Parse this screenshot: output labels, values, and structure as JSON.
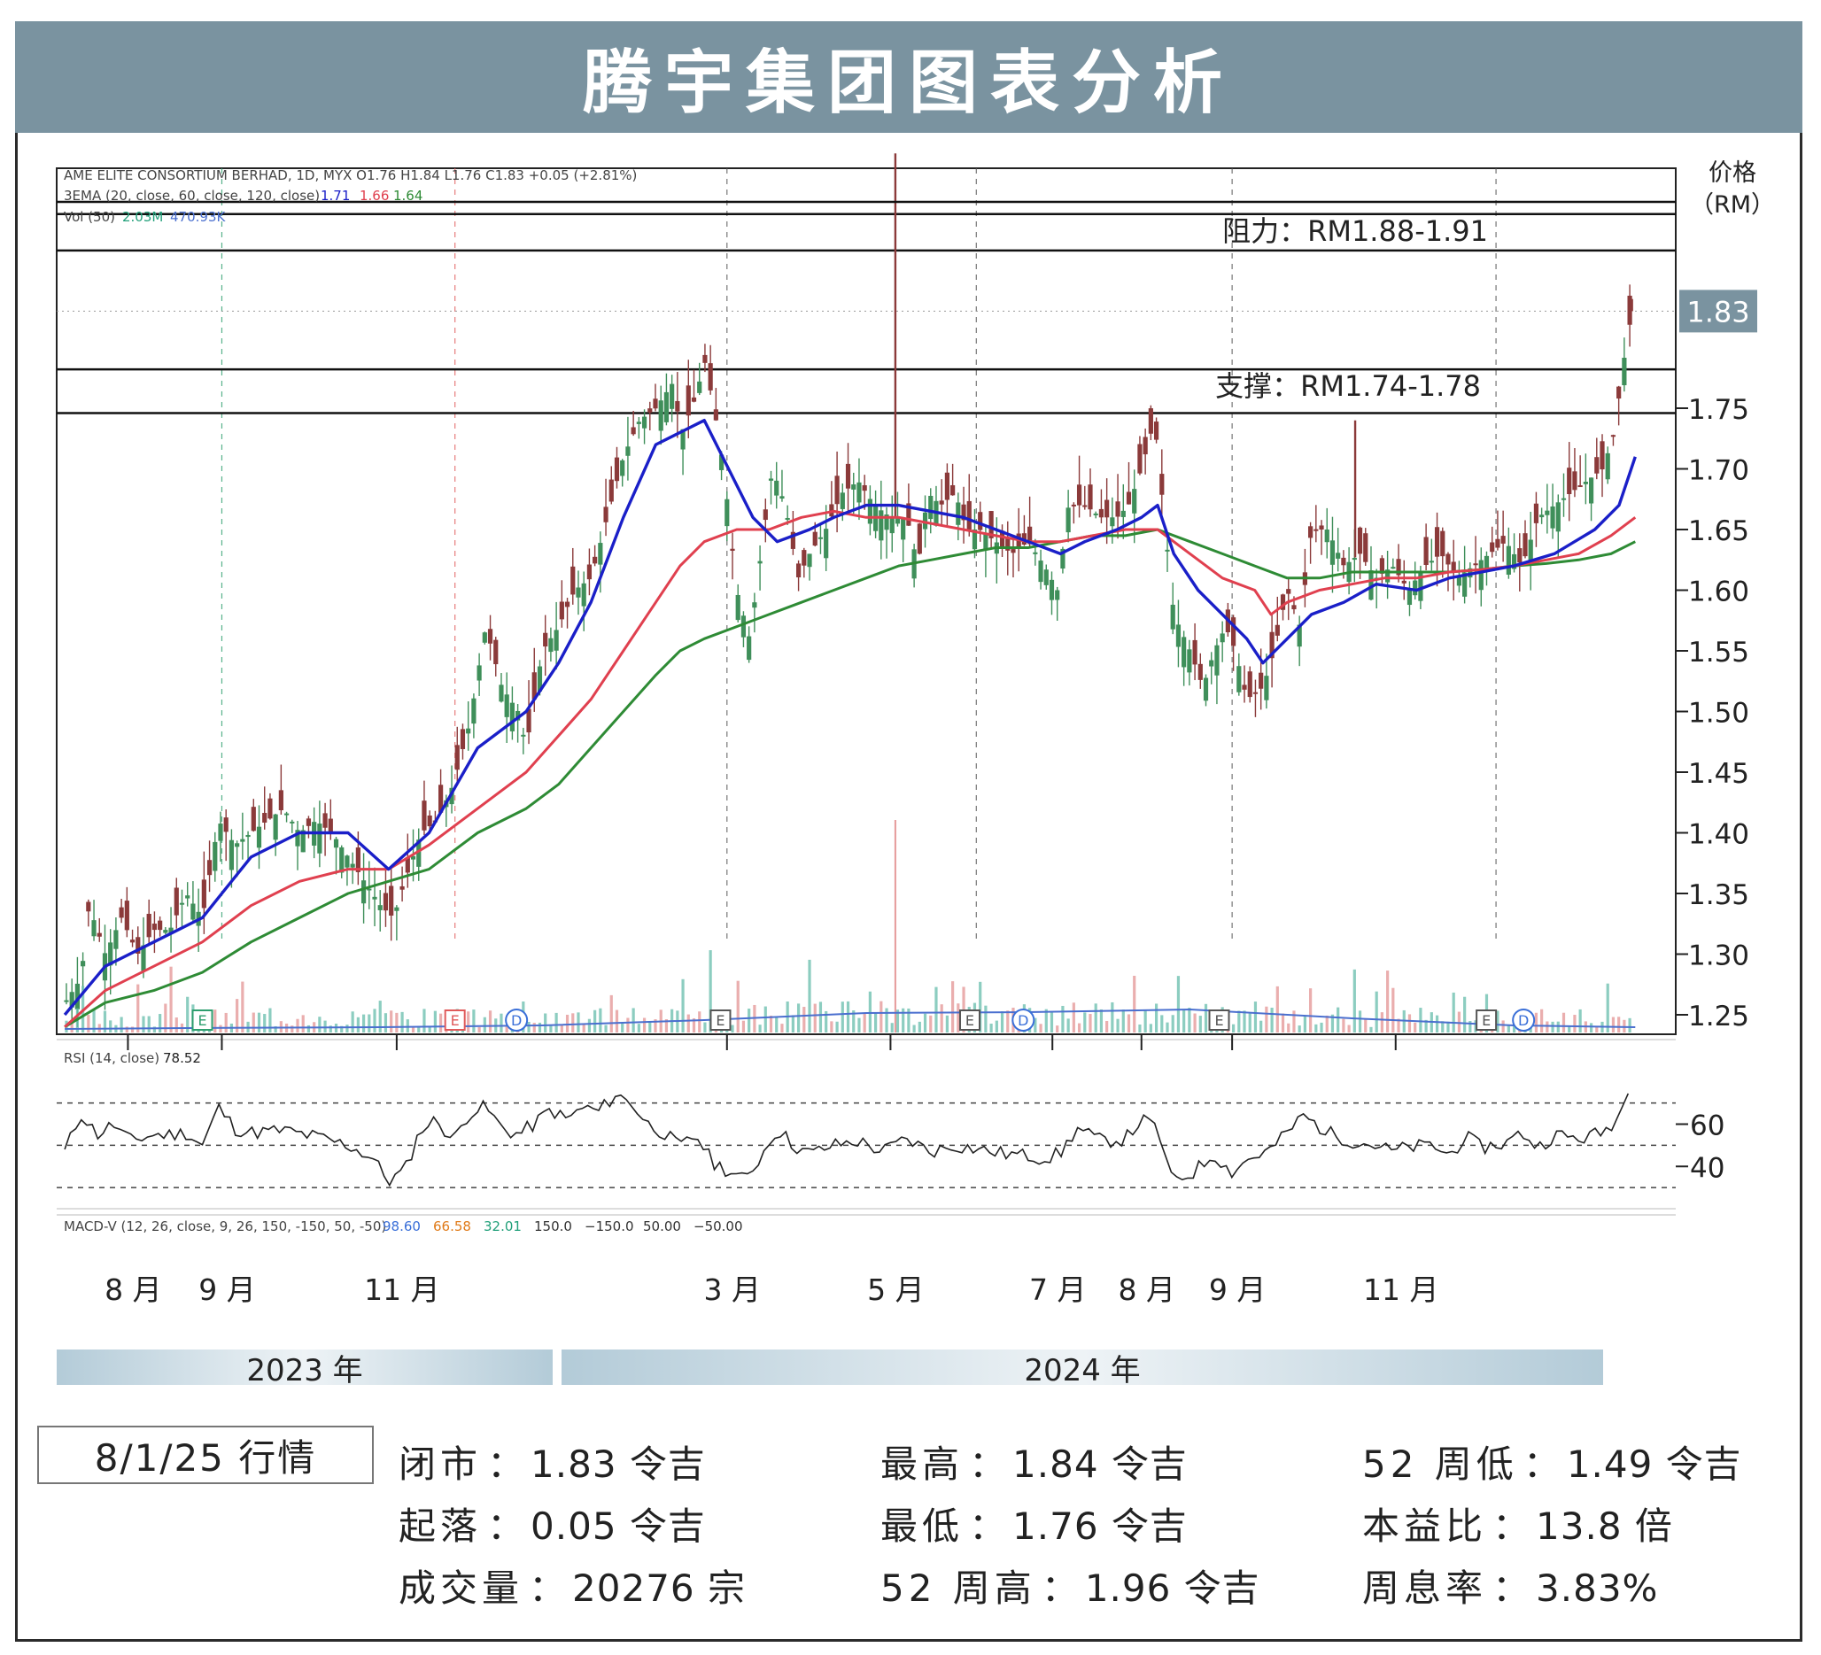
{
  "title": "腾宇集团图表分析",
  "price_axis": {
    "label_line1": "价格",
    "label_line2": "（RM）",
    "current_price": "1.83"
  },
  "chart_data": {
    "type": "candlestick",
    "legend_lines": [
      "AME ELITE CONSORTIUM BERHAD, 1D, MYX  O1.76  H1.84  L1.76  C1.83  +0.05 (+2.81%)",
      "3EMA (20, close, 60, close, 120, close)",
      "Vol (50)"
    ],
    "ema_values": [
      "1.71",
      "1.66",
      "1.64"
    ],
    "vol_values": [
      "2.03M",
      "470.93K"
    ],
    "y_range": [
      1.22,
      1.98
    ],
    "y_ticks": [
      1.25,
      1.3,
      1.35,
      1.4,
      1.45,
      1.5,
      1.55,
      1.6,
      1.65,
      1.7,
      1.75
    ],
    "x_range": [
      0,
      100
    ],
    "month_ticks": [
      {
        "x": 4.4,
        "label": "8 月"
      },
      {
        "x": 10.2,
        "label": "9 月"
      },
      {
        "x": 21.0,
        "label": "11 月"
      },
      {
        "x": 41.4,
        "label": "3 月"
      },
      {
        "x": 51.5,
        "label": "5 月"
      },
      {
        "x": 61.5,
        "label": "7 月"
      },
      {
        "x": 67.0,
        "label": "8 月"
      },
      {
        "x": 72.6,
        "label": "9 月"
      },
      {
        "x": 82.7,
        "label": "11 月"
      }
    ],
    "years": [
      "2023 年",
      "2024 年"
    ],
    "resistance": {
      "label": "阻力：RM1.88-1.91",
      "low": 1.88,
      "high": 1.91
    },
    "support": {
      "label": "支撑：RM1.74-1.78",
      "low": 1.746,
      "high": 1.782
    },
    "price_path": [
      [
        0.5,
        1.26
      ],
      [
        1.5,
        1.28
      ],
      [
        2,
        1.34
      ],
      [
        3,
        1.3
      ],
      [
        4,
        1.33
      ],
      [
        5,
        1.3
      ],
      [
        6,
        1.32
      ],
      [
        7,
        1.32
      ],
      [
        8,
        1.35
      ],
      [
        9,
        1.33
      ],
      [
        10,
        1.41
      ],
      [
        11,
        1.39
      ],
      [
        12,
        1.4
      ],
      [
        13,
        1.41
      ],
      [
        14,
        1.42
      ],
      [
        15,
        1.4
      ],
      [
        16,
        1.41
      ],
      [
        17,
        1.4
      ],
      [
        18,
        1.38
      ],
      [
        19,
        1.36
      ],
      [
        20,
        1.34
      ],
      [
        20.8,
        1.33
      ],
      [
        21.5,
        1.36
      ],
      [
        22.5,
        1.4
      ],
      [
        23.5,
        1.41
      ],
      [
        24.5,
        1.44
      ],
      [
        25.5,
        1.49
      ],
      [
        26.5,
        1.57
      ],
      [
        27.5,
        1.52
      ],
      [
        28.5,
        1.5
      ],
      [
        29,
        1.47
      ],
      [
        30,
        1.55
      ],
      [
        31,
        1.57
      ],
      [
        32,
        1.6
      ],
      [
        33,
        1.61
      ],
      [
        34,
        1.66
      ],
      [
        35,
        1.71
      ],
      [
        36,
        1.74
      ],
      [
        37,
        1.75
      ],
      [
        38,
        1.77
      ],
      [
        38.6,
        1.73
      ],
      [
        39.5,
        1.76
      ],
      [
        40,
        1.79
      ],
      [
        40.6,
        1.75
      ],
      [
        41.2,
        1.7
      ],
      [
        42,
        1.6
      ],
      [
        42.8,
        1.56
      ],
      [
        43.5,
        1.63
      ],
      [
        44.2,
        1.7
      ],
      [
        45,
        1.67
      ],
      [
        45.8,
        1.61
      ],
      [
        46.5,
        1.63
      ],
      [
        47.5,
        1.65
      ],
      [
        48.5,
        1.68
      ],
      [
        49.5,
        1.69
      ],
      [
        50.5,
        1.67
      ],
      [
        51.5,
        1.66
      ],
      [
        52.5,
        1.66
      ],
      [
        53.2,
        1.62
      ],
      [
        53.8,
        1.68
      ],
      [
        54.6,
        1.67
      ],
      [
        55.5,
        1.68
      ],
      [
        56.2,
        1.65
      ],
      [
        57,
        1.65
      ],
      [
        58,
        1.64
      ],
      [
        59,
        1.63
      ],
      [
        60,
        1.64
      ],
      [
        61,
        1.62
      ],
      [
        61.8,
        1.6
      ],
      [
        62.5,
        1.67
      ],
      [
        63.5,
        1.67
      ],
      [
        64.5,
        1.66
      ],
      [
        65.5,
        1.66
      ],
      [
        66.2,
        1.67
      ],
      [
        67,
        1.7
      ],
      [
        67.8,
        1.74
      ],
      [
        68.4,
        1.66
      ],
      [
        69,
        1.58
      ],
      [
        70,
        1.55
      ],
      [
        70.8,
        1.52
      ],
      [
        71.5,
        1.55
      ],
      [
        72.2,
        1.57
      ],
      [
        72.8,
        1.55
      ],
      [
        73.5,
        1.51
      ],
      [
        74.5,
        1.52
      ],
      [
        75.2,
        1.55
      ],
      [
        76,
        1.6
      ],
      [
        76.8,
        1.57
      ],
      [
        77.5,
        1.65
      ],
      [
        78.5,
        1.65
      ],
      [
        79.5,
        1.62
      ],
      [
        80.5,
        1.63
      ],
      [
        81.5,
        1.61
      ],
      [
        82.5,
        1.62
      ],
      [
        83.5,
        1.6
      ],
      [
        84.5,
        1.62
      ],
      [
        85.5,
        1.63
      ],
      [
        86.5,
        1.61
      ],
      [
        87.5,
        1.62
      ],
      [
        88.5,
        1.63
      ],
      [
        89.5,
        1.64
      ],
      [
        90.5,
        1.62
      ],
      [
        91.5,
        1.66
      ],
      [
        92.5,
        1.67
      ],
      [
        93.5,
        1.68
      ],
      [
        94.5,
        1.69
      ],
      [
        95.5,
        1.7
      ],
      [
        96.2,
        1.73
      ],
      [
        96.8,
        1.79
      ],
      [
        97.3,
        1.83
      ]
    ],
    "spikes": [
      [
        51.8,
        1.96
      ],
      [
        80.2,
        1.74
      ],
      [
        97.3,
        1.84
      ]
    ],
    "ema20": [
      [
        0.5,
        1.25
      ],
      [
        3,
        1.29
      ],
      [
        6,
        1.31
      ],
      [
        9,
        1.33
      ],
      [
        12,
        1.38
      ],
      [
        15,
        1.4
      ],
      [
        18,
        1.4
      ],
      [
        20.5,
        1.37
      ],
      [
        23,
        1.4
      ],
      [
        26,
        1.47
      ],
      [
        29,
        1.5
      ],
      [
        31,
        1.54
      ],
      [
        33,
        1.59
      ],
      [
        35,
        1.66
      ],
      [
        37,
        1.72
      ],
      [
        38.5,
        1.73
      ],
      [
        40,
        1.74
      ],
      [
        41.5,
        1.7
      ],
      [
        43,
        1.66
      ],
      [
        44.5,
        1.64
      ],
      [
        46.5,
        1.65
      ],
      [
        48,
        1.66
      ],
      [
        50,
        1.67
      ],
      [
        52,
        1.67
      ],
      [
        54,
        1.665
      ],
      [
        56,
        1.66
      ],
      [
        58,
        1.65
      ],
      [
        60,
        1.64
      ],
      [
        62,
        1.63
      ],
      [
        63.5,
        1.64
      ],
      [
        65.5,
        1.65
      ],
      [
        67,
        1.66
      ],
      [
        68,
        1.67
      ],
      [
        69,
        1.63
      ],
      [
        70.5,
        1.6
      ],
      [
        72,
        1.58
      ],
      [
        73.5,
        1.56
      ],
      [
        74.5,
        1.54
      ],
      [
        76,
        1.56
      ],
      [
        77.5,
        1.58
      ],
      [
        79.5,
        1.59
      ],
      [
        81.5,
        1.605
      ],
      [
        84,
        1.6
      ],
      [
        86,
        1.61
      ],
      [
        88,
        1.615
      ],
      [
        90,
        1.62
      ],
      [
        92.5,
        1.63
      ],
      [
        95,
        1.65
      ],
      [
        96.5,
        1.67
      ],
      [
        97.5,
        1.71
      ]
    ],
    "ema60": [
      [
        0.5,
        1.24
      ],
      [
        3,
        1.27
      ],
      [
        6,
        1.29
      ],
      [
        9,
        1.31
      ],
      [
        12,
        1.34
      ],
      [
        15,
        1.36
      ],
      [
        18,
        1.37
      ],
      [
        20.5,
        1.37
      ],
      [
        23,
        1.39
      ],
      [
        26,
        1.42
      ],
      [
        29,
        1.45
      ],
      [
        31,
        1.48
      ],
      [
        33,
        1.51
      ],
      [
        35,
        1.55
      ],
      [
        37,
        1.59
      ],
      [
        38.5,
        1.62
      ],
      [
        40,
        1.64
      ],
      [
        42,
        1.65
      ],
      [
        44,
        1.65
      ],
      [
        46,
        1.66
      ],
      [
        48,
        1.665
      ],
      [
        50,
        1.66
      ],
      [
        52,
        1.66
      ],
      [
        54,
        1.655
      ],
      [
        56,
        1.65
      ],
      [
        58,
        1.645
      ],
      [
        60,
        1.64
      ],
      [
        62,
        1.64
      ],
      [
        64,
        1.645
      ],
      [
        66,
        1.65
      ],
      [
        68,
        1.65
      ],
      [
        70,
        1.63
      ],
      [
        72,
        1.61
      ],
      [
        74,
        1.6
      ],
      [
        75,
        1.58
      ],
      [
        76,
        1.59
      ],
      [
        78,
        1.6
      ],
      [
        80,
        1.605
      ],
      [
        82,
        1.61
      ],
      [
        84,
        1.61
      ],
      [
        86,
        1.615
      ],
      [
        88,
        1.617
      ],
      [
        90,
        1.62
      ],
      [
        92,
        1.625
      ],
      [
        94,
        1.63
      ],
      [
        96,
        1.645
      ],
      [
        97.5,
        1.66
      ]
    ],
    "ema120": [
      [
        0.5,
        1.24
      ],
      [
        3,
        1.26
      ],
      [
        6,
        1.27
      ],
      [
        9,
        1.285
      ],
      [
        12,
        1.31
      ],
      [
        15,
        1.33
      ],
      [
        18,
        1.35
      ],
      [
        20.5,
        1.36
      ],
      [
        23,
        1.37
      ],
      [
        26,
        1.4
      ],
      [
        29,
        1.42
      ],
      [
        31,
        1.44
      ],
      [
        33,
        1.47
      ],
      [
        35,
        1.5
      ],
      [
        37,
        1.53
      ],
      [
        38.5,
        1.55
      ],
      [
        40,
        1.56
      ],
      [
        42,
        1.57
      ],
      [
        44,
        1.58
      ],
      [
        46,
        1.59
      ],
      [
        48,
        1.6
      ],
      [
        50,
        1.61
      ],
      [
        52,
        1.62
      ],
      [
        54,
        1.625
      ],
      [
        56,
        1.63
      ],
      [
        58,
        1.635
      ],
      [
        60,
        1.635
      ],
      [
        62,
        1.64
      ],
      [
        64,
        1.645
      ],
      [
        66,
        1.645
      ],
      [
        68,
        1.65
      ],
      [
        70,
        1.64
      ],
      [
        72,
        1.63
      ],
      [
        74,
        1.62
      ],
      [
        76,
        1.61
      ],
      [
        78,
        1.61
      ],
      [
        80,
        1.615
      ],
      [
        82,
        1.615
      ],
      [
        84,
        1.615
      ],
      [
        86,
        1.615
      ],
      [
        88,
        1.617
      ],
      [
        90,
        1.62
      ],
      [
        92,
        1.622
      ],
      [
        94,
        1.625
      ],
      [
        96,
        1.63
      ],
      [
        97.5,
        1.64
      ]
    ],
    "earnings_events": [
      {
        "x": 9.0,
        "kind": "E",
        "color": "#2e9e6e"
      },
      {
        "x": 24.6,
        "kind": "E",
        "color": "#e05a5a"
      },
      {
        "x": 28.4,
        "kind": "D",
        "color": "#3a6fd8"
      },
      {
        "x": 41.0,
        "kind": "E",
        "color": "#555555"
      },
      {
        "x": 56.4,
        "kind": "E",
        "color": "#555555"
      },
      {
        "x": 59.7,
        "kind": "D",
        "color": "#3a6fd8"
      },
      {
        "x": 71.8,
        "kind": "E",
        "color": "#555555"
      },
      {
        "x": 88.3,
        "kind": "E",
        "color": "#555555"
      },
      {
        "x": 90.6,
        "kind": "D",
        "color": "#3a6fd8"
      }
    ],
    "rsi": {
      "label": "RSI (14, close)",
      "value": "78.52",
      "range": [
        20,
        100
      ],
      "ticks": [
        60,
        40
      ],
      "levels": [
        70,
        50,
        30
      ],
      "path": [
        [
          0.5,
          47
        ],
        [
          1.5,
          65
        ],
        [
          2.5,
          55
        ],
        [
          3.5,
          60
        ],
        [
          4.5,
          52
        ],
        [
          6,
          55
        ],
        [
          7,
          55
        ],
        [
          8,
          56
        ],
        [
          9,
          50
        ],
        [
          10,
          68
        ],
        [
          11,
          58
        ],
        [
          12,
          56
        ],
        [
          14,
          57
        ],
        [
          16,
          54
        ],
        [
          18,
          50
        ],
        [
          19.5,
          44
        ],
        [
          20.5,
          33
        ],
        [
          21.5,
          38
        ],
        [
          22.5,
          58
        ],
        [
          23.5,
          62
        ],
        [
          24.5,
          52
        ],
        [
          25.5,
          66
        ],
        [
          26.5,
          68
        ],
        [
          27.5,
          58
        ],
        [
          28.5,
          55
        ],
        [
          29.5,
          60
        ],
        [
          30.5,
          67
        ],
        [
          31.5,
          62
        ],
        [
          32.5,
          68
        ],
        [
          33.5,
          66
        ],
        [
          34.5,
          74
        ],
        [
          35.5,
          70
        ],
        [
          36.5,
          60
        ],
        [
          37.5,
          56
        ],
        [
          38.5,
          49
        ],
        [
          39.5,
          55
        ],
        [
          40.5,
          42
        ],
        [
          41.5,
          38
        ],
        [
          42.5,
          33
        ],
        [
          43.5,
          45
        ],
        [
          44.5,
          58
        ],
        [
          45.5,
          50
        ],
        [
          46.5,
          46
        ],
        [
          48,
          50
        ],
        [
          49.5,
          52
        ],
        [
          51,
          47
        ],
        [
          52.5,
          53
        ],
        [
          54,
          47
        ],
        [
          55.5,
          50
        ],
        [
          57,
          48
        ],
        [
          58.5,
          46
        ],
        [
          60,
          45
        ],
        [
          61,
          44
        ],
        [
          62,
          46
        ],
        [
          63,
          58
        ],
        [
          64.5,
          52
        ],
        [
          66,
          53
        ],
        [
          67,
          62
        ],
        [
          68,
          58
        ],
        [
          68.8,
          34
        ],
        [
          70,
          36
        ],
        [
          71.5,
          46
        ],
        [
          72.5,
          37
        ],
        [
          73.5,
          43
        ],
        [
          75,
          48
        ],
        [
          76,
          56
        ],
        [
          77,
          64
        ],
        [
          78.5,
          56
        ],
        [
          80,
          52
        ],
        [
          81.5,
          50
        ],
        [
          82.5,
          47
        ],
        [
          83.5,
          49
        ],
        [
          85,
          50
        ],
        [
          86,
          45
        ],
        [
          87,
          54
        ],
        [
          88,
          49
        ],
        [
          89.5,
          51
        ],
        [
          90.5,
          56
        ],
        [
          91.5,
          49
        ],
        [
          92.5,
          55
        ],
        [
          94,
          53
        ],
        [
          95.5,
          56
        ],
        [
          96.5,
          64
        ],
        [
          97.3,
          79
        ]
      ]
    },
    "macd": {
      "label": "MACD-V (12, 26, close, 9, 26, 150, -150, 50, -50)",
      "values": [
        {
          "text": "98.60",
          "color": "#3a6fd8"
        },
        {
          "text": "66.58",
          "color": "#e07b1a"
        },
        {
          "text": "32.01",
          "color": "#22a07a"
        },
        {
          "text": "150.0",
          "color": "#333333"
        },
        {
          "text": "−150.0",
          "color": "#333333"
        },
        {
          "text": "50.00",
          "color": "#333333"
        },
        {
          "text": "−50.00",
          "color": "#333333"
        }
      ]
    },
    "colors": {
      "up": "#3f8f5a",
      "down": "#8b3a3a",
      "ema20": "#1a1fc8",
      "ema60": "#e0404f",
      "ema120": "#2e8b35",
      "volume": "#6fc0b0",
      "volume_down": "#e59a9a",
      "vol_ma": "#4a6fcf",
      "price_tag": "#7a93a0"
    }
  },
  "session": {
    "date": "8/1/25 行情"
  },
  "stats": [
    {
      "label": "闭市",
      "value": "1.83 令吉"
    },
    {
      "label": "最高",
      "value": "1.84 令吉"
    },
    {
      "label": "52 周低",
      "value": "1.49 令吉"
    },
    {
      "label": "起落",
      "value": "0.05 令吉"
    },
    {
      "label": "最低",
      "value": "1.76 令吉"
    },
    {
      "label": "本益比",
      "value": "13.8 倍"
    },
    {
      "label": "成交量",
      "value": "20276 宗"
    },
    {
      "label": "52 周高",
      "value": "1.96 令吉"
    },
    {
      "label": "周息率",
      "value": "3.83%"
    }
  ]
}
